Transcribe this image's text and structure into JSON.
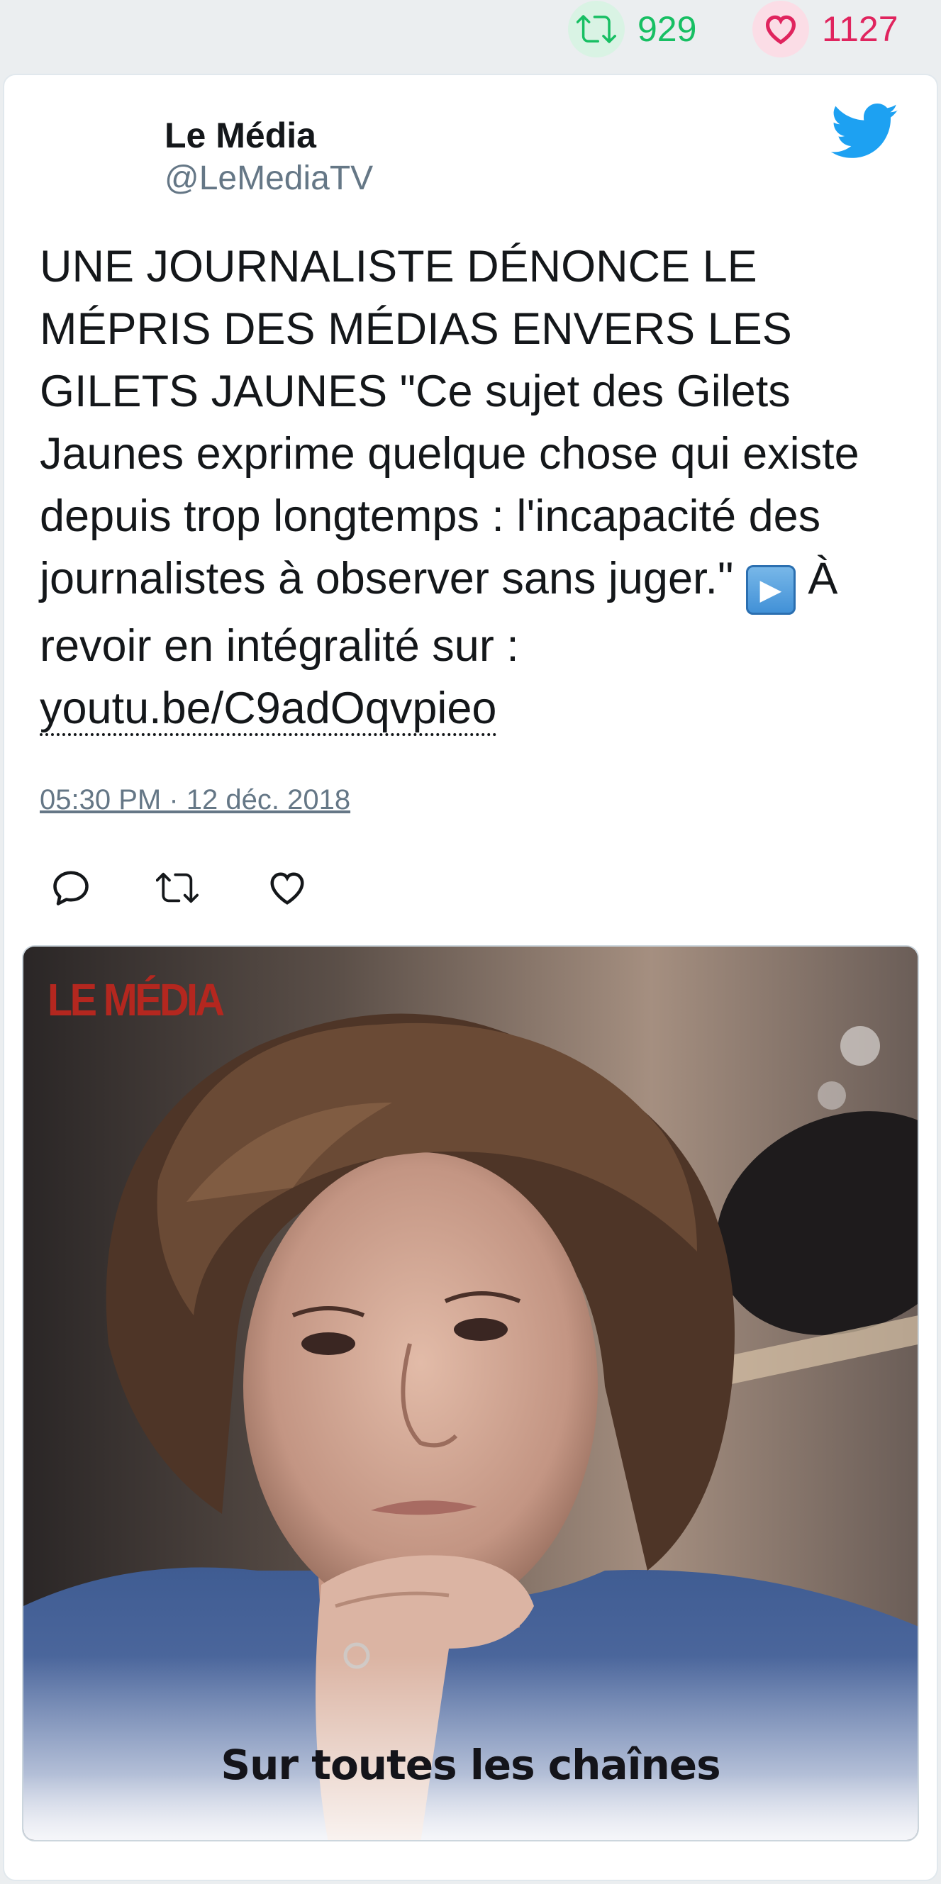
{
  "stats": {
    "retweets": "929",
    "likes": "1127",
    "retweet_icon": "retweet-icon",
    "like_icon": "heart-icon",
    "retweet_color": "#17bf63",
    "like_color": "#e0245e"
  },
  "author": {
    "name": "Le Média",
    "handle": "@LeMediaTV"
  },
  "tweet": {
    "text_main": "UNE JOURNALISTE DÉNONCE LE MÉPRIS DES MÉDIAS ENVERS LES GILETS JAUNES \"Ce sujet des Gilets Jaunes exprime quelque chose qui existe depuis trop longtemps : l'incapacité des journalistes à observer sans juger.\"",
    "play_emoji": "▶",
    "text_after": "À revoir en intégralité sur :",
    "link": "youtu.be/C9adOqvpieo",
    "timestamp": "05:30 PM · 12 déc. 2018"
  },
  "actions": {
    "reply_icon": "reply-icon",
    "retweet_icon": "retweet-icon",
    "like_icon": "heart-icon"
  },
  "media": {
    "logo_text": "LE MÉDIA",
    "caption": "Sur toutes les chaînes"
  },
  "colors": {
    "twitter_blue": "#1da1f2",
    "text": "#14171a",
    "secondary": "#657786"
  }
}
